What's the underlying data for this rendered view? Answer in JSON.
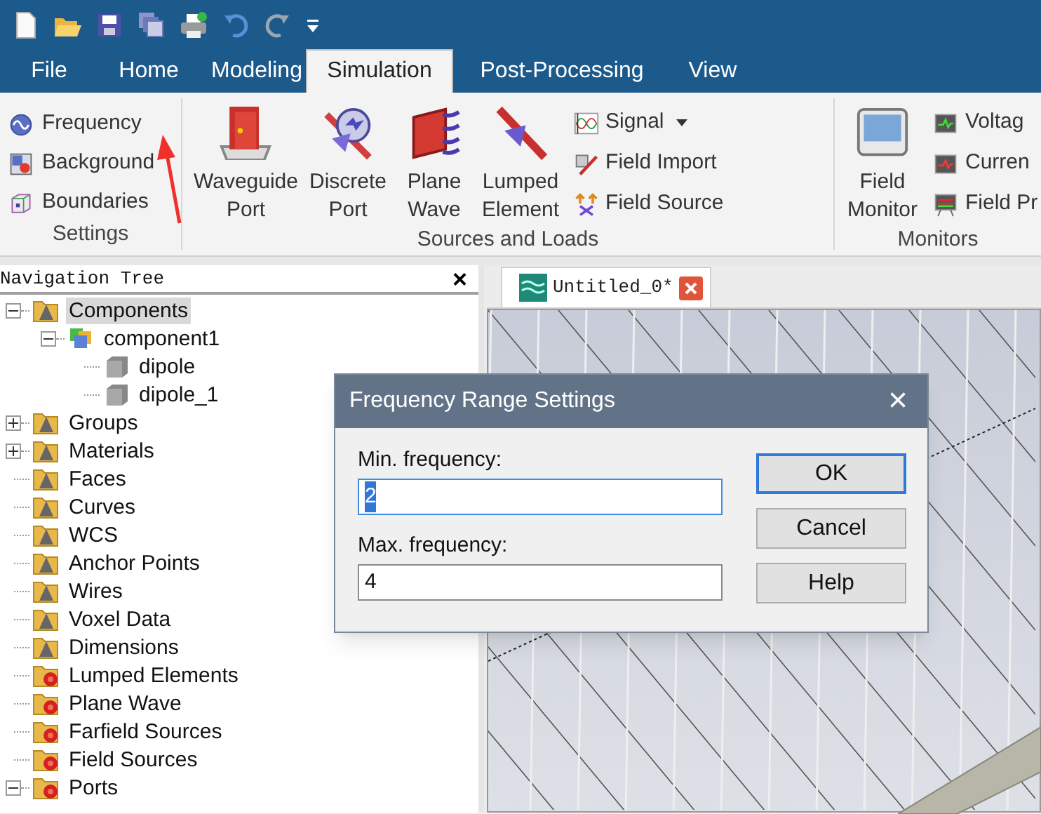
{
  "quick_access": [
    {
      "disabled": false
    },
    {
      "disabled": false
    },
    {
      "disabled": false
    },
    {
      "disabled": false
    },
    {
      "disabled": false
    },
    {
      "disabled": false
    },
    {
      "disabled": true
    },
    {
      "disabled": false
    }
  ],
  "tabs": [
    {
      "label": "File",
      "selected": false
    },
    {
      "label": "Home",
      "selected": false
    },
    {
      "label": "Modeling",
      "selected": false
    },
    {
      "label": "Simulation",
      "selected": true
    },
    {
      "label": "Post-Processing",
      "selected": false
    },
    {
      "label": "View",
      "selected": false
    }
  ],
  "ribbon": [
    {
      "label": "Settings",
      "items": [
        {
          "kind": "small",
          "label": "Frequency"
        },
        {
          "kind": "small",
          "label": "Background"
        },
        {
          "kind": "small",
          "label": "Boundaries"
        }
      ]
    },
    {
      "label": "Sources and Loads",
      "items": [
        {
          "kind": "large",
          "label": "Waveguide Port"
        },
        {
          "kind": "large",
          "label": "Discrete Port"
        },
        {
          "kind": "large",
          "label": "Plane Wave"
        },
        {
          "kind": "large",
          "label": "Lumped Element"
        },
        {
          "kind": "column",
          "items": [
            {
              "label": "Signal",
              "dropdown": true
            },
            {
              "label": "Field Import",
              "dropdown": false
            },
            {
              "label": "Field Source",
              "dropdown": false
            }
          ]
        }
      ]
    },
    {
      "label": "Monitors",
      "items": [
        {
          "kind": "large",
          "label": "Field Monitor"
        },
        {
          "kind": "column",
          "items": [
            {
              "label": "Voltag"
            },
            {
              "label": "Curren"
            },
            {
              "label": "Field Pr"
            }
          ]
        }
      ]
    }
  ],
  "navigation_tree": {
    "title": "Navigation Tree",
    "close": "×",
    "items": [
      {
        "label": "Components",
        "kind": "folder",
        "expanded": true,
        "selected": true,
        "children": [
          {
            "label": "component1",
            "kind": "component",
            "expanded": true,
            "selected": false,
            "children": [
              {
                "label": "dipole",
                "kind": "solid",
                "selected": false
              },
              {
                "label": "dipole_1",
                "kind": "solid",
                "selected": false
              }
            ]
          }
        ]
      },
      {
        "label": "Groups",
        "kind": "folder",
        "expanded": false,
        "selected": false
      },
      {
        "label": "Materials",
        "kind": "folder",
        "expanded": false,
        "selected": false
      },
      {
        "label": "Faces",
        "kind": "folder",
        "selected": false
      },
      {
        "label": "Curves",
        "kind": "folder",
        "selected": false
      },
      {
        "label": "WCS",
        "kind": "folder",
        "selected": false
      },
      {
        "label": "Anchor Points",
        "kind": "folder",
        "selected": false
      },
      {
        "label": "Wires",
        "kind": "folder",
        "selected": false
      },
      {
        "label": "Voxel Data",
        "kind": "folder",
        "selected": false
      },
      {
        "label": "Dimensions",
        "kind": "folder",
        "selected": false
      },
      {
        "label": "Lumped Elements",
        "kind": "source",
        "selected": false
      },
      {
        "label": "Plane Wave",
        "kind": "source",
        "selected": false
      },
      {
        "label": "Farfield Sources",
        "kind": "source",
        "selected": false
      },
      {
        "label": "Field Sources",
        "kind": "source",
        "selected": false
      },
      {
        "label": "Ports",
        "kind": "source",
        "expanded": true,
        "selected": false
      }
    ]
  },
  "document_tabs": [
    {
      "label": "Untitled_0*",
      "selected": true
    }
  ],
  "dialog": {
    "title": "Frequency Range Settings",
    "close": "×",
    "fields": [
      {
        "label": "Min. frequency:",
        "value": "2",
        "focused": true
      },
      {
        "label": "Max. frequency:",
        "value": "4",
        "focused": false
      }
    ],
    "buttons": [
      {
        "label": "OK",
        "default": true
      },
      {
        "label": "Cancel",
        "default": false
      },
      {
        "label": "Help",
        "default": false
      }
    ]
  }
}
